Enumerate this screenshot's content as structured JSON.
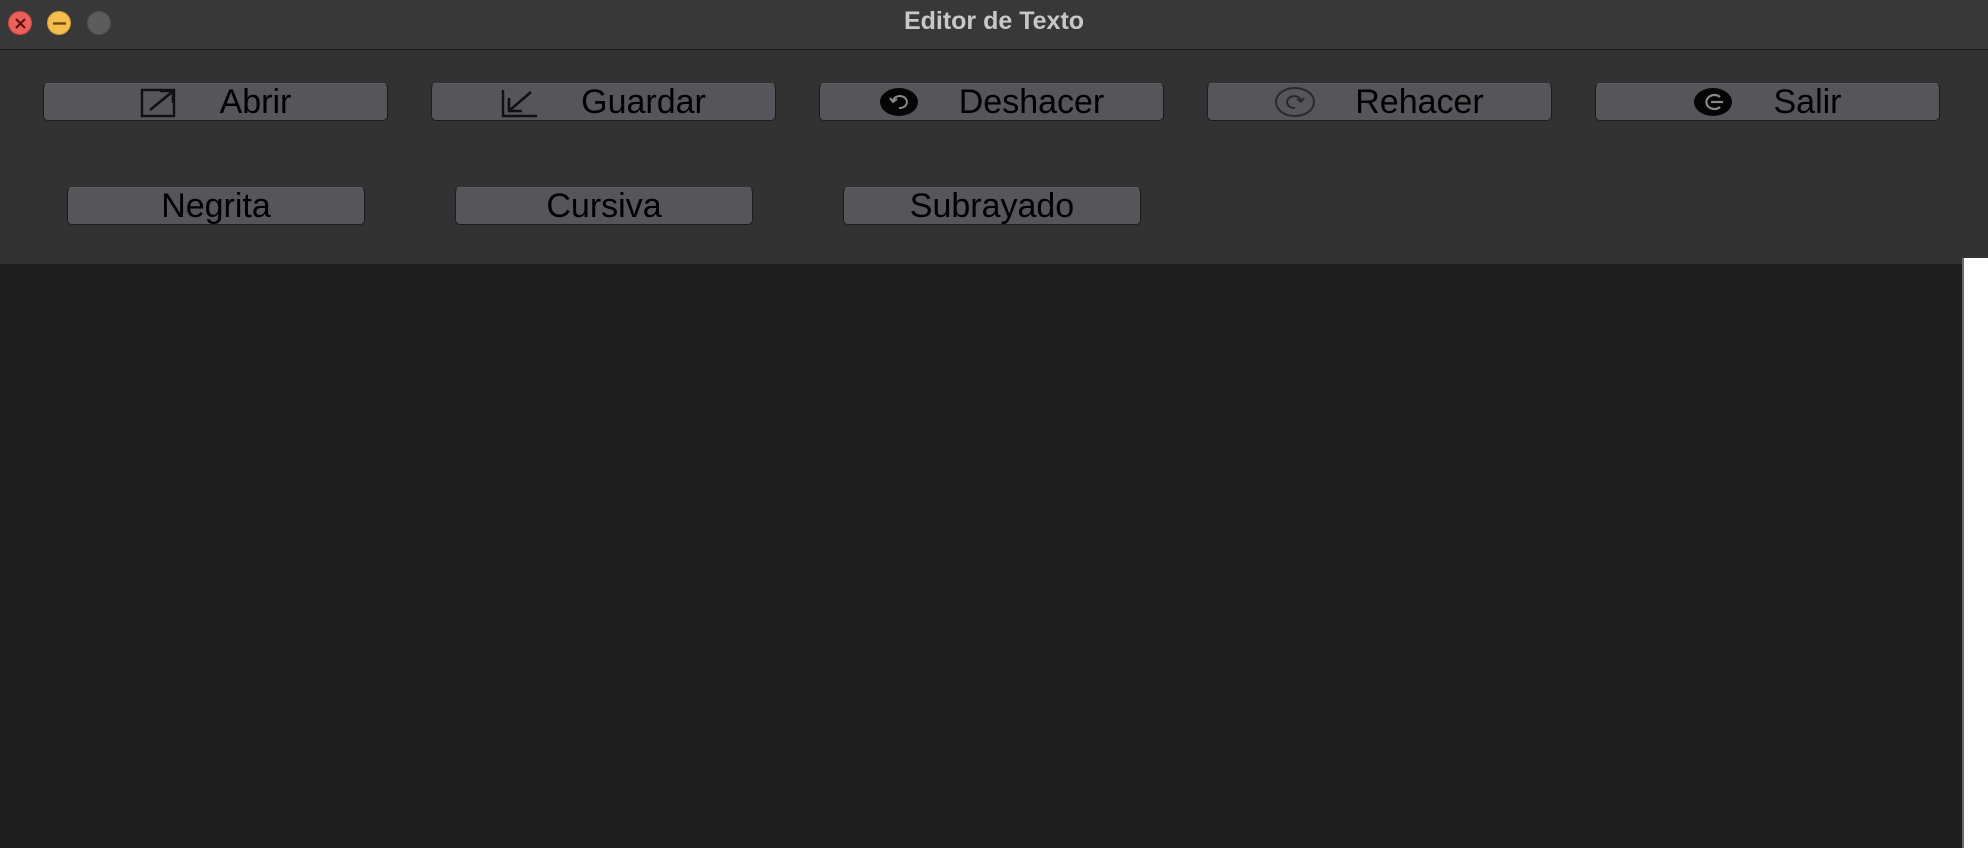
{
  "window": {
    "title": "Editor de Texto"
  },
  "toolbar": {
    "row1": [
      {
        "label": "Abrir",
        "icon": "open-arrow-icon"
      },
      {
        "label": "Guardar",
        "icon": "save-arrow-icon"
      },
      {
        "label": "Deshacer",
        "icon": "undo-icon"
      },
      {
        "label": "Rehacer",
        "icon": "redo-icon"
      },
      {
        "label": "Salir",
        "icon": "exit-icon"
      }
    ],
    "row2": [
      {
        "label": "Negrita"
      },
      {
        "label": "Cursiva"
      },
      {
        "label": "Subrayado"
      }
    ]
  },
  "colors": {
    "close": "#ec5f5a",
    "minimize": "#f4be4f",
    "maximize_disabled": "#5c5c5c",
    "button_face": "#55555a",
    "toolbar_bg": "#323232",
    "editor_bg": "#1f1f1f"
  }
}
